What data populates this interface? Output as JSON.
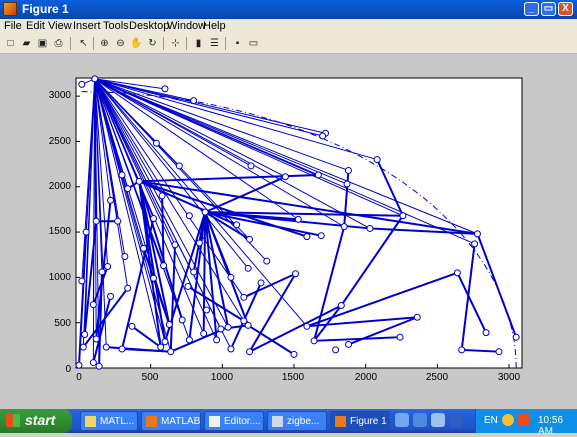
{
  "window": {
    "title": "Figure 1",
    "minimize": "_",
    "maximize": "▭",
    "close": "X"
  },
  "menu": [
    "File",
    "Edit",
    "View",
    "Insert",
    "Tools",
    "Desktop",
    "Window",
    "Help"
  ],
  "toolbar": [
    {
      "name": "new-figure-icon",
      "glyph": "□"
    },
    {
      "name": "open-file-icon",
      "glyph": "▰"
    },
    {
      "name": "save-icon",
      "glyph": "▣"
    },
    {
      "name": "print-icon",
      "glyph": "⎙"
    },
    {
      "name": "select-arrow-icon",
      "glyph": "↖"
    },
    {
      "name": "zoom-in-icon",
      "glyph": "⊕"
    },
    {
      "name": "zoom-out-icon",
      "glyph": "⊖"
    },
    {
      "name": "pan-hand-icon",
      "glyph": "✋"
    },
    {
      "name": "rotate-3d-icon",
      "glyph": "↻"
    },
    {
      "name": "data-cursor-icon",
      "glyph": "⊹"
    },
    {
      "name": "colorbar-icon",
      "glyph": "▮"
    },
    {
      "name": "legend-icon",
      "glyph": "☰"
    },
    {
      "name": "hide-plot-tools-icon",
      "glyph": "▪"
    },
    {
      "name": "show-plot-tools-icon",
      "glyph": "▭"
    }
  ],
  "chart_data": {
    "type": "scatter",
    "xlim": [
      0,
      3000
    ],
    "ylim": [
      0,
      3200
    ],
    "xticks": [
      "0",
      "500",
      "1000",
      "1500",
      "2000",
      "2500",
      "3000"
    ],
    "yticks": [
      "0",
      "500",
      "1000",
      "1500",
      "2000",
      "2500",
      "3000"
    ],
    "series_color": "#0000cc",
    "hub": [
      110,
      3190
    ],
    "points": [
      [
        20,
        3130
      ],
      [
        600,
        3080
      ],
      [
        800,
        2950
      ],
      [
        1720,
        2590
      ],
      [
        1700,
        2560
      ],
      [
        2080,
        2300
      ],
      [
        1880,
        2180
      ],
      [
        1870,
        2030
      ],
      [
        1440,
        2110
      ],
      [
        540,
        2480
      ],
      [
        700,
        2230
      ],
      [
        1200,
        2230
      ],
      [
        1670,
        2130
      ],
      [
        300,
        2130
      ],
      [
        420,
        2060
      ],
      [
        220,
        1850
      ],
      [
        340,
        1980
      ],
      [
        580,
        1900
      ],
      [
        770,
        1680
      ],
      [
        880,
        1720
      ],
      [
        1100,
        1580
      ],
      [
        520,
        1650
      ],
      [
        270,
        1620
      ],
      [
        120,
        1620
      ],
      [
        50,
        1500
      ],
      [
        1530,
        1640
      ],
      [
        1850,
        1560
      ],
      [
        2260,
        1680
      ],
      [
        2030,
        1540
      ],
      [
        2780,
        1480
      ],
      [
        2760,
        1370
      ],
      [
        1590,
        1450
      ],
      [
        1690,
        1460
      ],
      [
        1190,
        1420
      ],
      [
        840,
        1380
      ],
      [
        670,
        1360
      ],
      [
        450,
        1320
      ],
      [
        320,
        1230
      ],
      [
        200,
        1120
      ],
      [
        160,
        1060
      ],
      [
        590,
        1130
      ],
      [
        800,
        1060
      ],
      [
        1060,
        1000
      ],
      [
        1180,
        1100
      ],
      [
        1310,
        1180
      ],
      [
        2640,
        1050
      ],
      [
        1510,
        1040
      ],
      [
        1270,
        940
      ],
      [
        1150,
        780
      ],
      [
        760,
        900
      ],
      [
        520,
        990
      ],
      [
        340,
        880
      ],
      [
        220,
        790
      ],
      [
        100,
        700
      ],
      [
        20,
        960
      ],
      [
        370,
        460
      ],
      [
        720,
        530
      ],
      [
        890,
        640
      ],
      [
        1040,
        450
      ],
      [
        1180,
        470
      ],
      [
        990,
        430
      ],
      [
        870,
        380
      ],
      [
        630,
        480
      ],
      [
        600,
        290
      ],
      [
        570,
        230
      ],
      [
        770,
        310
      ],
      [
        960,
        310
      ],
      [
        1060,
        210
      ],
      [
        1190,
        180
      ],
      [
        1500,
        150
      ],
      [
        1640,
        300
      ],
      [
        1830,
        690
      ],
      [
        2360,
        560
      ],
      [
        2240,
        340
      ],
      [
        1880,
        260
      ],
      [
        1790,
        200
      ],
      [
        2670,
        200
      ],
      [
        2840,
        390
      ],
      [
        2930,
        180
      ],
      [
        3050,
        340
      ],
      [
        300,
        210
      ],
      [
        190,
        230
      ],
      [
        120,
        320
      ],
      [
        40,
        370
      ],
      [
        0,
        30
      ],
      [
        100,
        60
      ],
      [
        140,
        20
      ],
      [
        30,
        230
      ],
      [
        640,
        180
      ],
      [
        1150,
        520
      ],
      [
        1590,
        460
      ]
    ],
    "hub_links": [
      0,
      1,
      2,
      3,
      4,
      5,
      6,
      7,
      8,
      9,
      10,
      11,
      12,
      13,
      14,
      15,
      16,
      17,
      21,
      22,
      23,
      24,
      25,
      26,
      27,
      28,
      29,
      30,
      33,
      35,
      36,
      37,
      38,
      39,
      40,
      43,
      44,
      48,
      51,
      53,
      54,
      56,
      58,
      60,
      61,
      62,
      63,
      64,
      65,
      66,
      67,
      81,
      82,
      83,
      84,
      85,
      86,
      87,
      88,
      89,
      90
    ],
    "thick_links": [
      [
        [
          880,
          1720
        ],
        [
          1530,
          1640
        ]
      ],
      [
        [
          880,
          1720
        ],
        [
          2260,
          1680
        ]
      ],
      [
        [
          880,
          1720
        ],
        [
          1690,
          1460
        ]
      ],
      [
        [
          880,
          1720
        ],
        [
          2030,
          1540
        ]
      ],
      [
        [
          880,
          1720
        ],
        [
          1190,
          1420
        ]
      ],
      [
        [
          880,
          1720
        ],
        [
          600,
          290
        ]
      ],
      [
        [
          880,
          1720
        ],
        [
          770,
          310
        ]
      ],
      [
        [
          880,
          1720
        ],
        [
          1040,
          450
        ]
      ],
      [
        [
          880,
          1720
        ],
        [
          960,
          310
        ]
      ],
      [
        [
          880,
          1720
        ],
        [
          870,
          380
        ]
      ],
      [
        [
          880,
          1720
        ],
        [
          1180,
          470
        ]
      ],
      [
        [
          880,
          1720
        ],
        [
          1060,
          1000
        ]
      ],
      [
        [
          880,
          1720
        ],
        [
          800,
          1060
        ]
      ],
      [
        [
          420,
          2060
        ],
        [
          1100,
          1580
        ]
      ],
      [
        [
          420,
          2060
        ],
        [
          1670,
          2130
        ]
      ],
      [
        [
          420,
          2060
        ],
        [
          1590,
          1450
        ]
      ],
      [
        [
          420,
          2060
        ],
        [
          2780,
          1480
        ]
      ],
      [
        [
          420,
          2060
        ],
        [
          570,
          230
        ]
      ],
      [
        [
          420,
          2060
        ],
        [
          630,
          480
        ]
      ],
      [
        [
          420,
          2060
        ],
        [
          720,
          530
        ]
      ],
      [
        [
          420,
          2060
        ],
        [
          600,
          290
        ]
      ],
      [
        [
          2780,
          1480
        ],
        [
          3050,
          340
        ]
      ],
      [
        [
          2760,
          1370
        ],
        [
          2670,
          200
        ]
      ],
      [
        [
          2670,
          200
        ],
        [
          2930,
          180
        ]
      ],
      [
        [
          2640,
          1050
        ],
        [
          2840,
          390
        ]
      ],
      [
        [
          2260,
          1680
        ],
        [
          1830,
          690
        ]
      ],
      [
        [
          1830,
          690
        ],
        [
          1640,
          300
        ]
      ],
      [
        [
          1850,
          1560
        ],
        [
          1640,
          300
        ]
      ],
      [
        [
          1830,
          690
        ],
        [
          1190,
          180
        ]
      ],
      [
        [
          1640,
          300
        ],
        [
          2240,
          340
        ]
      ],
      [
        [
          1880,
          260
        ],
        [
          2360,
          560
        ]
      ],
      [
        [
          1500,
          150
        ],
        [
          1180,
          470
        ]
      ],
      [
        [
          1510,
          1040
        ],
        [
          1150,
          780
        ]
      ],
      [
        [
          1510,
          1040
        ],
        [
          1190,
          180
        ]
      ],
      [
        [
          1270,
          940
        ],
        [
          1060,
          210
        ]
      ],
      [
        [
          1180,
          470
        ],
        [
          990,
          430
        ]
      ],
      [
        [
          640,
          180
        ],
        [
          1040,
          450
        ]
      ],
      [
        [
          640,
          180
        ],
        [
          300,
          210
        ]
      ],
      [
        [
          640,
          180
        ],
        [
          190,
          230
        ]
      ],
      [
        [
          570,
          230
        ],
        [
          370,
          460
        ]
      ],
      [
        [
          220,
          1850
        ],
        [
          120,
          320
        ]
      ],
      [
        [
          120,
          1620
        ],
        [
          40,
          370
        ]
      ],
      [
        [
          120,
          1620
        ],
        [
          270,
          1620
        ]
      ],
      [
        [
          200,
          1120
        ],
        [
          100,
          700
        ]
      ],
      [
        [
          50,
          1500
        ],
        [
          0,
          30
        ]
      ],
      [
        [
          160,
          1060
        ],
        [
          140,
          20
        ]
      ],
      [
        [
          340,
          880
        ],
        [
          30,
          230
        ]
      ],
      [
        [
          220,
          790
        ],
        [
          100,
          60
        ]
      ],
      [
        [
          520,
          1650
        ],
        [
          300,
          210
        ]
      ],
      [
        [
          450,
          1320
        ],
        [
          630,
          480
        ]
      ],
      [
        [
          670,
          1360
        ],
        [
          640,
          180
        ]
      ],
      [
        [
          760,
          900
        ],
        [
          1150,
          520
        ]
      ],
      [
        [
          2640,
          1050
        ],
        [
          1590,
          460
        ]
      ],
      [
        [
          1590,
          460
        ],
        [
          2360,
          560
        ]
      ],
      [
        [
          2030,
          1540
        ],
        [
          2780,
          1480
        ]
      ],
      [
        [
          2080,
          2300
        ],
        [
          2260,
          1680
        ]
      ],
      [
        [
          1880,
          2180
        ],
        [
          1850,
          1560
        ]
      ],
      [
        [
          1440,
          2110
        ],
        [
          880,
          1720
        ]
      ],
      [
        [
          340,
          1980
        ],
        [
          420,
          2060
        ]
      ],
      [
        [
          580,
          1900
        ],
        [
          590,
          1130
        ]
      ]
    ]
  },
  "taskbar": {
    "start": "start",
    "tasks": [
      {
        "label": "MATL...",
        "icon": "folder",
        "active": false
      },
      {
        "label": "MATLAB",
        "icon": "matlab",
        "active": false
      },
      {
        "label": "Editor....",
        "icon": "editor",
        "active": false
      },
      {
        "label": "zigbe...",
        "icon": "zigbee",
        "active": false
      },
      {
        "label": "Figure 1",
        "icon": "matlab",
        "active": true
      }
    ],
    "lang": "EN",
    "clock": "10:56 AM"
  }
}
